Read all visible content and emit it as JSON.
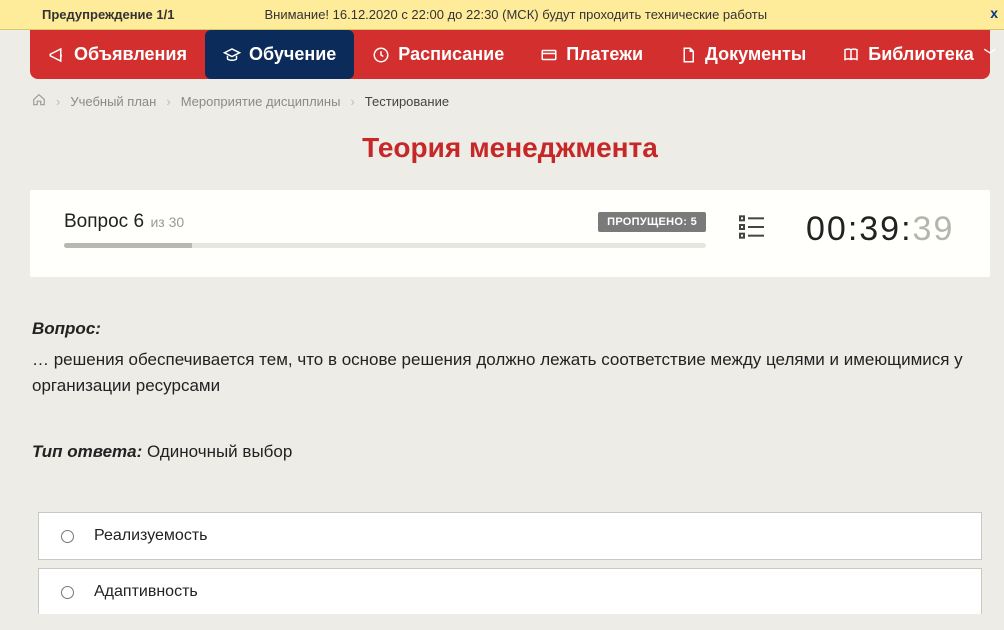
{
  "banner": {
    "label": "Предупреждение 1/1",
    "message": "Внимание! 16.12.2020 с 22:00 до 22:30 (МСК) будут проходить технические работы",
    "close": "x"
  },
  "nav": {
    "items": [
      {
        "label": "Объявления",
        "icon": "megaphone-icon"
      },
      {
        "label": "Обучение",
        "icon": "graduation-icon",
        "active": true
      },
      {
        "label": "Расписание",
        "icon": "clock-icon"
      },
      {
        "label": "Платежи",
        "icon": "card-icon"
      },
      {
        "label": "Документы",
        "icon": "document-icon"
      },
      {
        "label": "Библиотека",
        "icon": "book-icon",
        "chevron": true
      }
    ]
  },
  "breadcrumb": {
    "items": [
      "Учебный план",
      "Мероприятие дисциплины",
      "Тестирование"
    ]
  },
  "page_title": "Теория менеджмента",
  "question_card": {
    "label": "Вопрос 6",
    "total": "из 30",
    "skipped": "ПРОПУЩЕНО: 5",
    "timer_main": "00:39:",
    "timer_sec": "39"
  },
  "question": {
    "head": "Вопрос:",
    "text": "… решения обеспечивается тем, что в основе решения должно лежать соответствие между целями и имеющимися у организации ресурсами",
    "ans_type_label": "Тип ответа:",
    "ans_type_value": " Одиночный выбор"
  },
  "options": [
    "Реализуемость",
    "Адаптивность"
  ]
}
